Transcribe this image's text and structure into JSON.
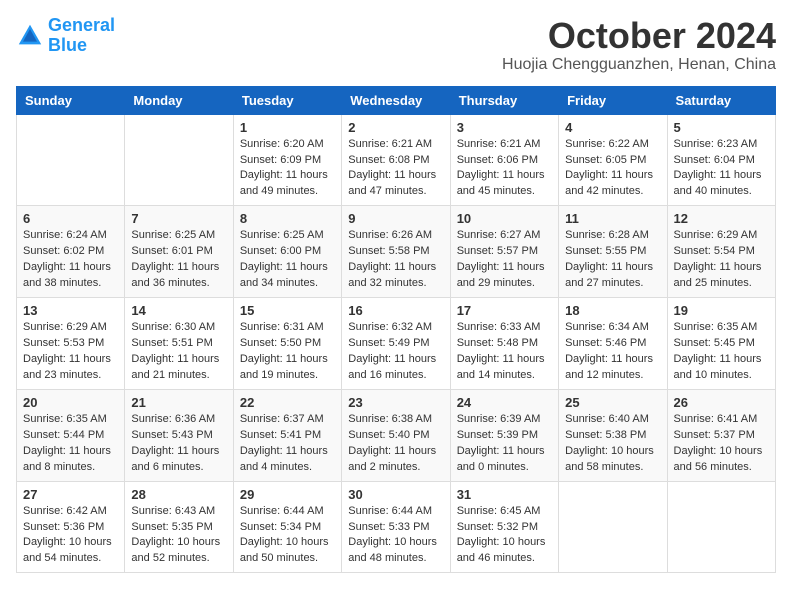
{
  "logo": {
    "line1": "General",
    "line2": "Blue"
  },
  "title": "October 2024",
  "location": "Huojia Chengguanzhen, Henan, China",
  "days_of_week": [
    "Sunday",
    "Monday",
    "Tuesday",
    "Wednesday",
    "Thursday",
    "Friday",
    "Saturday"
  ],
  "weeks": [
    [
      {
        "day": "",
        "sunrise": "",
        "sunset": "",
        "daylight": ""
      },
      {
        "day": "",
        "sunrise": "",
        "sunset": "",
        "daylight": ""
      },
      {
        "day": "1",
        "sunrise": "Sunrise: 6:20 AM",
        "sunset": "Sunset: 6:09 PM",
        "daylight": "Daylight: 11 hours and 49 minutes."
      },
      {
        "day": "2",
        "sunrise": "Sunrise: 6:21 AM",
        "sunset": "Sunset: 6:08 PM",
        "daylight": "Daylight: 11 hours and 47 minutes."
      },
      {
        "day": "3",
        "sunrise": "Sunrise: 6:21 AM",
        "sunset": "Sunset: 6:06 PM",
        "daylight": "Daylight: 11 hours and 45 minutes."
      },
      {
        "day": "4",
        "sunrise": "Sunrise: 6:22 AM",
        "sunset": "Sunset: 6:05 PM",
        "daylight": "Daylight: 11 hours and 42 minutes."
      },
      {
        "day": "5",
        "sunrise": "Sunrise: 6:23 AM",
        "sunset": "Sunset: 6:04 PM",
        "daylight": "Daylight: 11 hours and 40 minutes."
      }
    ],
    [
      {
        "day": "6",
        "sunrise": "Sunrise: 6:24 AM",
        "sunset": "Sunset: 6:02 PM",
        "daylight": "Daylight: 11 hours and 38 minutes."
      },
      {
        "day": "7",
        "sunrise": "Sunrise: 6:25 AM",
        "sunset": "Sunset: 6:01 PM",
        "daylight": "Daylight: 11 hours and 36 minutes."
      },
      {
        "day": "8",
        "sunrise": "Sunrise: 6:25 AM",
        "sunset": "Sunset: 6:00 PM",
        "daylight": "Daylight: 11 hours and 34 minutes."
      },
      {
        "day": "9",
        "sunrise": "Sunrise: 6:26 AM",
        "sunset": "Sunset: 5:58 PM",
        "daylight": "Daylight: 11 hours and 32 minutes."
      },
      {
        "day": "10",
        "sunrise": "Sunrise: 6:27 AM",
        "sunset": "Sunset: 5:57 PM",
        "daylight": "Daylight: 11 hours and 29 minutes."
      },
      {
        "day": "11",
        "sunrise": "Sunrise: 6:28 AM",
        "sunset": "Sunset: 5:55 PM",
        "daylight": "Daylight: 11 hours and 27 minutes."
      },
      {
        "day": "12",
        "sunrise": "Sunrise: 6:29 AM",
        "sunset": "Sunset: 5:54 PM",
        "daylight": "Daylight: 11 hours and 25 minutes."
      }
    ],
    [
      {
        "day": "13",
        "sunrise": "Sunrise: 6:29 AM",
        "sunset": "Sunset: 5:53 PM",
        "daylight": "Daylight: 11 hours and 23 minutes."
      },
      {
        "day": "14",
        "sunrise": "Sunrise: 6:30 AM",
        "sunset": "Sunset: 5:51 PM",
        "daylight": "Daylight: 11 hours and 21 minutes."
      },
      {
        "day": "15",
        "sunrise": "Sunrise: 6:31 AM",
        "sunset": "Sunset: 5:50 PM",
        "daylight": "Daylight: 11 hours and 19 minutes."
      },
      {
        "day": "16",
        "sunrise": "Sunrise: 6:32 AM",
        "sunset": "Sunset: 5:49 PM",
        "daylight": "Daylight: 11 hours and 16 minutes."
      },
      {
        "day": "17",
        "sunrise": "Sunrise: 6:33 AM",
        "sunset": "Sunset: 5:48 PM",
        "daylight": "Daylight: 11 hours and 14 minutes."
      },
      {
        "day": "18",
        "sunrise": "Sunrise: 6:34 AM",
        "sunset": "Sunset: 5:46 PM",
        "daylight": "Daylight: 11 hours and 12 minutes."
      },
      {
        "day": "19",
        "sunrise": "Sunrise: 6:35 AM",
        "sunset": "Sunset: 5:45 PM",
        "daylight": "Daylight: 11 hours and 10 minutes."
      }
    ],
    [
      {
        "day": "20",
        "sunrise": "Sunrise: 6:35 AM",
        "sunset": "Sunset: 5:44 PM",
        "daylight": "Daylight: 11 hours and 8 minutes."
      },
      {
        "day": "21",
        "sunrise": "Sunrise: 6:36 AM",
        "sunset": "Sunset: 5:43 PM",
        "daylight": "Daylight: 11 hours and 6 minutes."
      },
      {
        "day": "22",
        "sunrise": "Sunrise: 6:37 AM",
        "sunset": "Sunset: 5:41 PM",
        "daylight": "Daylight: 11 hours and 4 minutes."
      },
      {
        "day": "23",
        "sunrise": "Sunrise: 6:38 AM",
        "sunset": "Sunset: 5:40 PM",
        "daylight": "Daylight: 11 hours and 2 minutes."
      },
      {
        "day": "24",
        "sunrise": "Sunrise: 6:39 AM",
        "sunset": "Sunset: 5:39 PM",
        "daylight": "Daylight: 11 hours and 0 minutes."
      },
      {
        "day": "25",
        "sunrise": "Sunrise: 6:40 AM",
        "sunset": "Sunset: 5:38 PM",
        "daylight": "Daylight: 10 hours and 58 minutes."
      },
      {
        "day": "26",
        "sunrise": "Sunrise: 6:41 AM",
        "sunset": "Sunset: 5:37 PM",
        "daylight": "Daylight: 10 hours and 56 minutes."
      }
    ],
    [
      {
        "day": "27",
        "sunrise": "Sunrise: 6:42 AM",
        "sunset": "Sunset: 5:36 PM",
        "daylight": "Daylight: 10 hours and 54 minutes."
      },
      {
        "day": "28",
        "sunrise": "Sunrise: 6:43 AM",
        "sunset": "Sunset: 5:35 PM",
        "daylight": "Daylight: 10 hours and 52 minutes."
      },
      {
        "day": "29",
        "sunrise": "Sunrise: 6:44 AM",
        "sunset": "Sunset: 5:34 PM",
        "daylight": "Daylight: 10 hours and 50 minutes."
      },
      {
        "day": "30",
        "sunrise": "Sunrise: 6:44 AM",
        "sunset": "Sunset: 5:33 PM",
        "daylight": "Daylight: 10 hours and 48 minutes."
      },
      {
        "day": "31",
        "sunrise": "Sunrise: 6:45 AM",
        "sunset": "Sunset: 5:32 PM",
        "daylight": "Daylight: 10 hours and 46 minutes."
      },
      {
        "day": "",
        "sunrise": "",
        "sunset": "",
        "daylight": ""
      },
      {
        "day": "",
        "sunrise": "",
        "sunset": "",
        "daylight": ""
      }
    ]
  ]
}
